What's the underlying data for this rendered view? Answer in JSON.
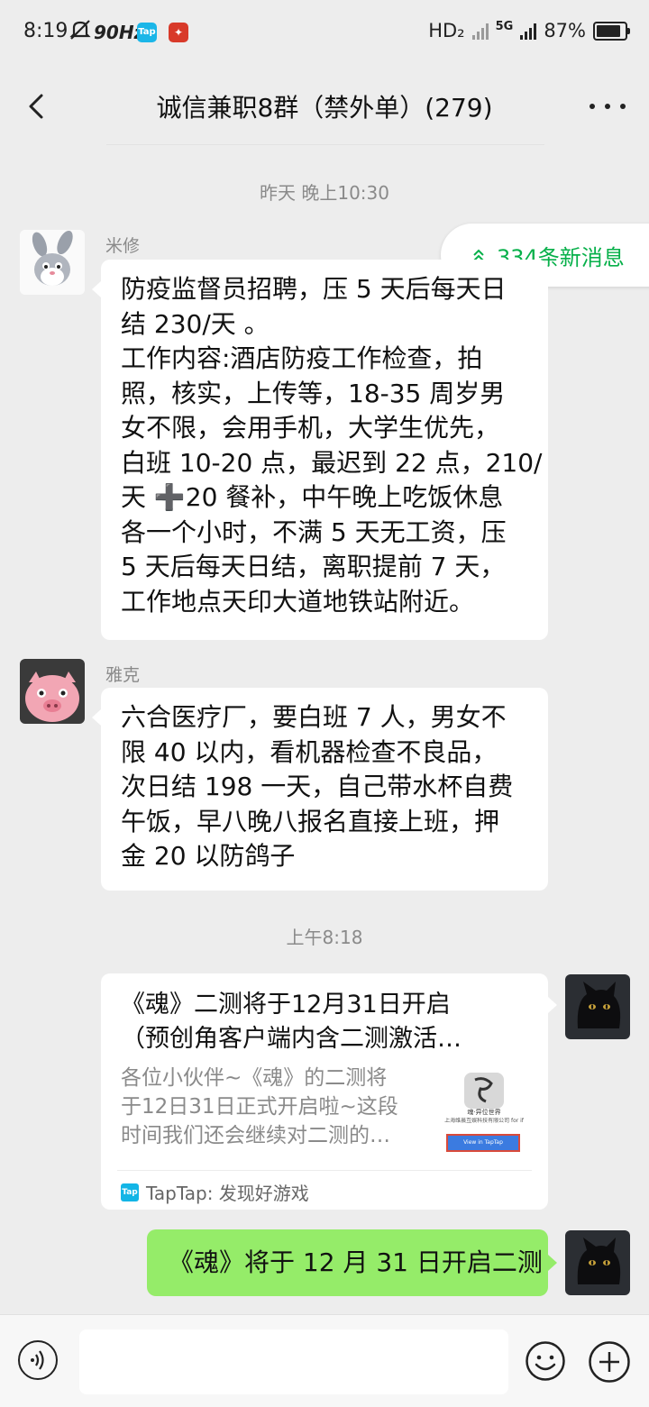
{
  "status_bar": {
    "time": "8:19",
    "refresh_rate": "90Hz",
    "hd_label": "HD₂",
    "network": "5G",
    "battery": "87%",
    "battery_level": 0.87
  },
  "header": {
    "title": "诚信兼职8群（禁外单）(279)"
  },
  "new_messages": {
    "label": "334条新消息",
    "accent": "#07b04a"
  },
  "messages": [
    {
      "timestamp": "昨天 晚上10:30",
      "sender": "米修",
      "lines": [
        "防疫监督员招聘，压 5 天后每天日",
        "结 230/天 。",
        "工作内容:酒店防疫工作检查，拍",
        "照，核实，上传等，18-35 周岁男",
        "女不限，会用手机，大学生优先，",
        "白班 10-20 点，最迟到 22 点，210/",
        "天 ➕20 餐补，中午晚上吃饭休息",
        "各一个小时，不满 5 天无工资，压",
        "5 天后每天日结，离职提前 7 天，",
        "工作地点天印大道地铁站附近。"
      ]
    },
    {
      "sender": "雅克",
      "lines": [
        "六合医疗厂，要白班 7 人，男女不",
        "限 40 以内，看机器检查不良品，",
        "次日结 198 一天，自己带水杯自费",
        "午饭，早八晚八报名直接上班，押",
        "金 20 以防鸽子"
      ]
    }
  ],
  "timestamp_2": "上午8:18",
  "link_card": {
    "title_lines": [
      "《魂》二测将于12月31日开启",
      "（预创角客户端内含二测激活…"
    ],
    "desc_lines": [
      "各位小伙伴~《魂》的二测将",
      "于12日31日正式开启啦~这段",
      "时间我们还会继续对二测的…"
    ],
    "thumb_caption": "魂·异位世界",
    "thumb_company": "上海维晨互娱科技有限公司 for if",
    "thumb_button": "View in TapTap",
    "source_icon": "Tap",
    "source": "TapTap: 发现好游戏"
  },
  "sent_message": "《魂》将于 12 月 31 日开启二测",
  "colors": {
    "background": "#ededed",
    "sent_bubble": "#95ec69",
    "received_bubble": "#ffffff"
  }
}
